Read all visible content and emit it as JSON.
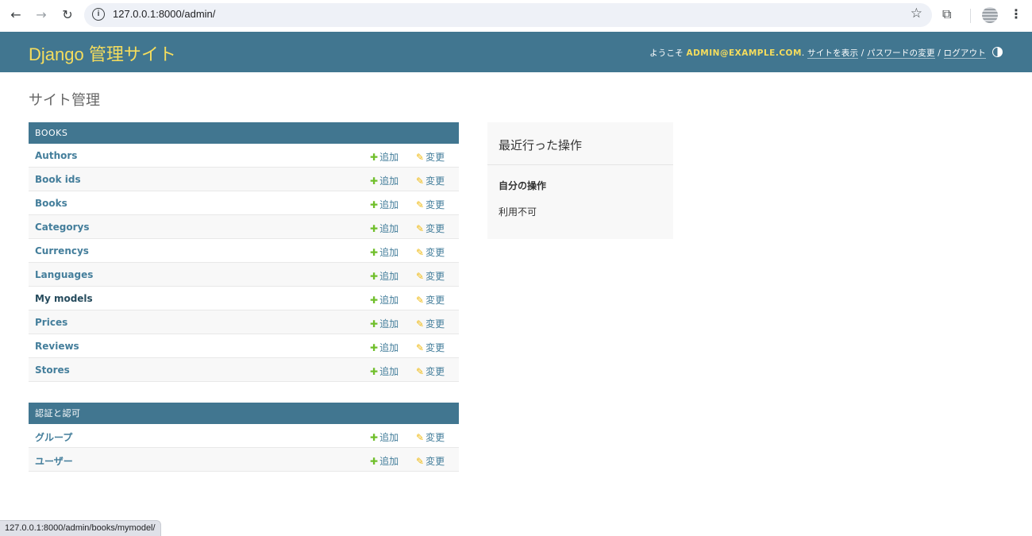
{
  "browser": {
    "url": "127.0.0.1:8000/admin/",
    "status_url": "127.0.0.1:8000/admin/books/mymodel/"
  },
  "header": {
    "branding": "Django 管理サイト",
    "welcome": "ようこそ",
    "user": "ADMIN@EXAMPLE.COM",
    "view_site": "サイトを表示",
    "change_password": "パスワードの変更",
    "logout": "ログアウト",
    "separator": "/"
  },
  "page_title": "サイト管理",
  "actions": {
    "add": "追加",
    "change": "変更"
  },
  "apps": [
    {
      "name": "BOOKS",
      "models": [
        "Authors",
        "Book ids",
        "Books",
        "Categorys",
        "Currencys",
        "Languages",
        "My models",
        "Prices",
        "Reviews",
        "Stores"
      ]
    },
    {
      "name": "認証と認可",
      "models": [
        "グループ",
        "ユーザー"
      ]
    }
  ],
  "recent_actions": {
    "title": "最近行った操作",
    "my_actions": "自分の操作",
    "none": "利用不可"
  },
  "colors": {
    "header_bg": "#417690",
    "branding": "#f5dd5d",
    "link": "#447e9b",
    "add_icon": "#70bf2b",
    "change_icon": "#efb80b"
  }
}
